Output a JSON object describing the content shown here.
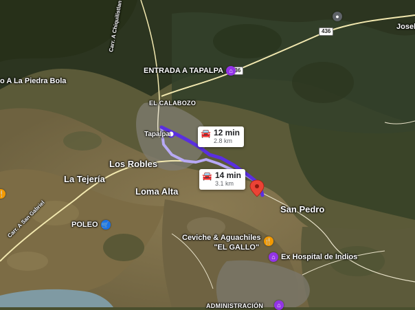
{
  "labels": {
    "entrada": "ENTRADA A TAPALPA",
    "calabozo": "EL CALABOZO",
    "tapalpa": "Tapalpa",
    "los_robles": "Los Robles",
    "la_tejeria": "La Tejería",
    "loma_alta": "Loma Alta",
    "san_pedro": "San Pedro",
    "poleo": "POLEO",
    "ceviche_line1": "Ceviche & Aguachiles",
    "ceviche_line2": "\"EL GALLO\"",
    "ex_hospital": "Ex Hospital de Indios",
    "piedra_bola": "o A La Piedra Bola",
    "joseli": "Joseli",
    "bottom_partial": "ADMINISTRACIÓN"
  },
  "roads": {
    "chiquilistlan": "Carr. A Chiquilistlan",
    "san_gabriel": "Carr. A San Gabriel",
    "route_436_a": "436",
    "route_436_b": "436"
  },
  "route_cards": {
    "primary": {
      "time": "12 min",
      "distance": "2.8 km",
      "icon": "car-icon"
    },
    "alternate": {
      "time": "14 min",
      "distance": "3.1 km",
      "icon": "car-icon"
    }
  },
  "colors": {
    "route_primary": "#5a2fe0",
    "route_alternate": "#b7a9f5",
    "destination_pin": "#ea4335",
    "poi_purple": "#9334e6",
    "poi_orange": "#f29900",
    "poi_blue": "#1a73e8"
  }
}
